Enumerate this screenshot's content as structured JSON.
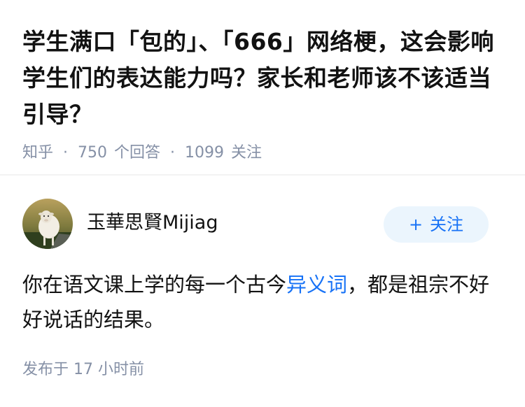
{
  "question": {
    "title": "学生满口「包的」、「666」网络梗，这会影响学生们的表达能力吗？家长和老师该不该适当引导？",
    "site": "知乎",
    "separator": "·",
    "answer_count": "750",
    "answer_label": "个回答",
    "follower_count": "1099",
    "follower_label": "关注"
  },
  "author": {
    "avatar_icon": "sheep-avatar",
    "name": "玉華思賢Mijiag",
    "follow_plus": "+",
    "follow_label": "关注",
    "follow_color": "#1772f6",
    "follow_bg": "#ebf5fd"
  },
  "answer": {
    "text_before_link": "你在语文课上学的每一个古今",
    "link_text": "异义词",
    "text_after_link": "，都是祖宗不好好说话的结果。",
    "publish_time": "发布于 17 小时前"
  },
  "colors": {
    "text": "#121212",
    "meta": "#8590a6",
    "link": "#1772f6"
  }
}
